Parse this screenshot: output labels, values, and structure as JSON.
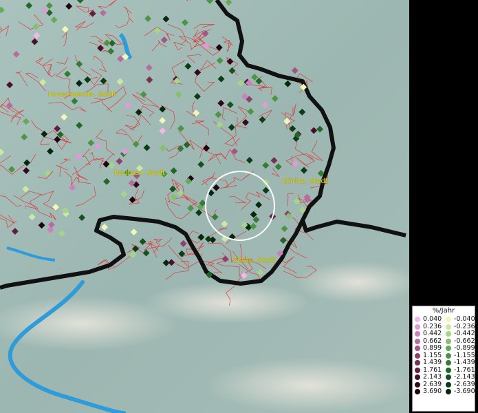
{
  "places": [
    {
      "name": "Hoyerswerda, Stadt"
    },
    {
      "name": "Bautzen, Stadt"
    },
    {
      "name": "Görlitz, Stadt"
    },
    {
      "name": "Zittau, Stadt"
    }
  ],
  "legend": {
    "title": "%/Jahr",
    "rows": [
      {
        "pos": "0.040",
        "pos_color": "#f4b7ea",
        "neg": "-0.040",
        "neg_color": "#f0f7b8"
      },
      {
        "pos": "0.236",
        "pos_color": "#e19ad6",
        "neg": "-0.236",
        "neg_color": "#cde8a3"
      },
      {
        "pos": "0.442",
        "pos_color": "#cc81bb",
        "neg": "-0.442",
        "neg_color": "#a6d58a"
      },
      {
        "pos": "0.662",
        "pos_color": "#b76c9f",
        "neg": "-0.662",
        "neg_color": "#85c06f"
      },
      {
        "pos": "0.899",
        "pos_color": "#a35685",
        "neg": "-0.899",
        "neg_color": "#66a956"
      },
      {
        "pos": "1.155",
        "pos_color": "#8e406b",
        "neg": "-1.155",
        "neg_color": "#4d9444"
      },
      {
        "pos": "1.439",
        "pos_color": "#782e55",
        "neg": "-1.439",
        "neg_color": "#357c36"
      },
      {
        "pos": "1.761",
        "pos_color": "#621d40",
        "neg": "-1.761",
        "neg_color": "#22672a"
      },
      {
        "pos": "2.143",
        "pos_color": "#4c102e",
        "neg": "-2.143",
        "neg_color": "#145220"
      },
      {
        "pos": "2.639",
        "pos_color": "#35071d",
        "neg": "-2.639",
        "neg_color": "#0a3d16"
      },
      {
        "pos": "3.690",
        "pos_color": "#1f020f",
        "neg": "-3.690",
        "neg_color": "#03280d"
      }
    ]
  },
  "colors": {
    "border": "#111111",
    "admin_lines": "#e03b3b",
    "river": "#2f9bd8",
    "highlight_circle": "#ffffff",
    "label": "#e6d800"
  }
}
